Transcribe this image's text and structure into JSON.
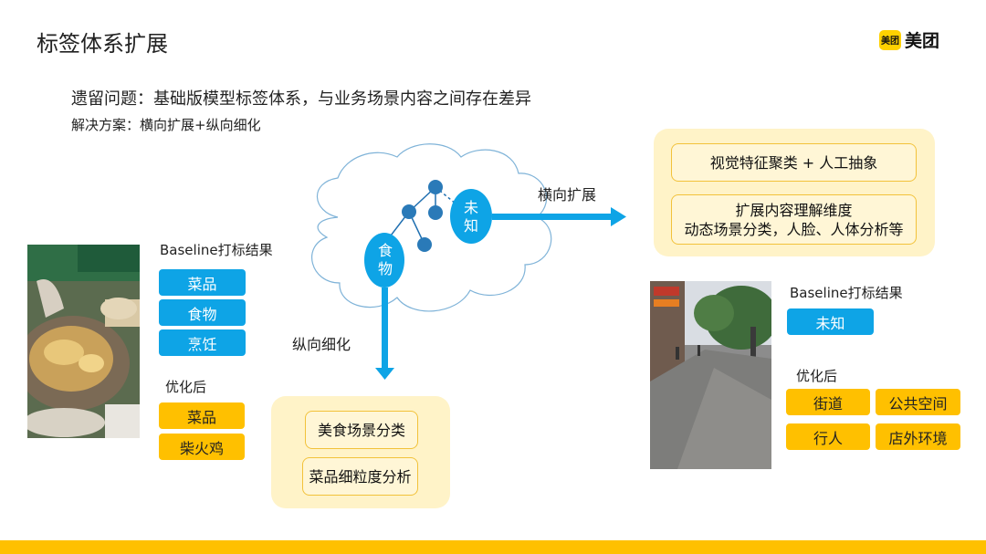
{
  "slide": {
    "title": "标签体系扩展",
    "logo_mark": "美团",
    "logo_text": "美团",
    "issue": "遗留问题：基础版模型标签体系，与业务场景内容之间存在差异",
    "solution": "解决方案：横向扩展+纵向细化"
  },
  "left_example": {
    "baseline_caption": "Baseline打标结果",
    "baseline_tags": [
      "菜品",
      "食物",
      "烹饪"
    ],
    "optimized_caption": "优化后",
    "optimized_tags": [
      "菜品",
      "柴火鸡"
    ]
  },
  "diagram": {
    "food_node": "食物",
    "unknown_node": "未知",
    "horizontal_label": "横向扩展",
    "vertical_label": "纵向细化"
  },
  "horizontal_panel": {
    "items": [
      "视觉特征聚类 + 人工抽象"
    ],
    "multi_item": {
      "line1": "扩展内容理解维度",
      "line2": "动态场景分类，人脸、人体分析等"
    }
  },
  "vertical_panel": {
    "items": [
      "美食场景分类",
      "菜品细粒度分析"
    ]
  },
  "right_example": {
    "baseline_caption": "Baseline打标结果",
    "baseline_tags": [
      "未知"
    ],
    "optimized_caption": "优化后",
    "optimized_tags": [
      "街道",
      "公共空间",
      "行人",
      "店外环境"
    ]
  },
  "colors": {
    "blue": "#0ea4e6",
    "yellow": "#ffc000",
    "panel": "#fff3c8"
  }
}
